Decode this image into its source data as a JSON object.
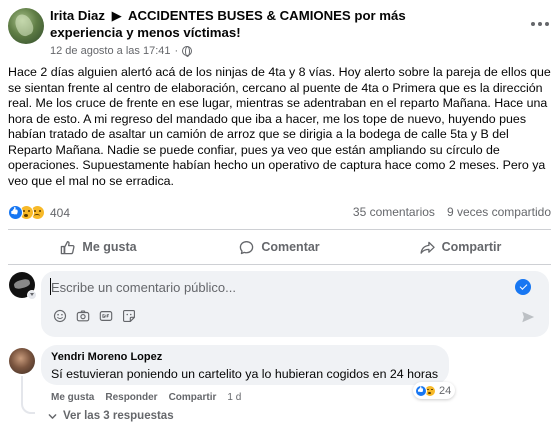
{
  "post": {
    "author": "Irita Diaz",
    "arrow": "▶",
    "group": "ACCIDENTES BUSES & CAMIONES por más experiencia y menos víctimas!",
    "timestamp": "12 de agosto a las 17:41",
    "dot": "·",
    "privacy_icon": "globe-icon",
    "body": "Hace 2 días alguien alertó acá de los ninjas de 4ta y 8 vías. Hoy alerto sobre la pareja de ellos que se sientan frente al centro de elaboración, cercano al puente de 4ta o Primera que es la dirección real. Me los cruce de frente en ese lugar, mientras se adentraban en el reparto Mañana. Hace una hora de esto. A mi regreso del mandado que iba a hacer, me los tope de nuevo, huyendo pues habían tratado de asaltar un camión de arroz que se dirigia a la bodega de  calle 5ta y B del Reparto Mañana. Nadie se puede confiar, pues ya veo que están ampliando su círculo de operaciones. Supuestamente habían hecho un operativo de captura hace como 2 meses. Pero ya veo que el mal no se erradica."
  },
  "stats": {
    "reaction_icons": [
      "like-icon",
      "wow-icon",
      "sad-icon"
    ],
    "reaction_count": "404",
    "comments": "35 comentarios",
    "shares": "9 veces compartido"
  },
  "actions": {
    "like": "Me gusta",
    "comment": "Comentar",
    "share": "Compartir"
  },
  "composer": {
    "placeholder": "Escribe un comentario público...",
    "tools": [
      "emoji-icon",
      "camera-icon",
      "gif-icon",
      "sticker-icon"
    ]
  },
  "comment": {
    "author": "Yendri Moreno Lopez",
    "text": "Sí estuvieran poniendo un cartelito ya lo hubieran cogidos en 24 horas",
    "reaction_count": "24",
    "like": "Me gusta",
    "reply": "Responder",
    "share": "Compartir",
    "time": "1 d",
    "replies": "Ver las 3 respuestas"
  },
  "colors": {
    "accent": "#1877f2",
    "secondary_text": "#65676b",
    "bubble": "#f0f2f5",
    "divider": "#ced0d4"
  }
}
